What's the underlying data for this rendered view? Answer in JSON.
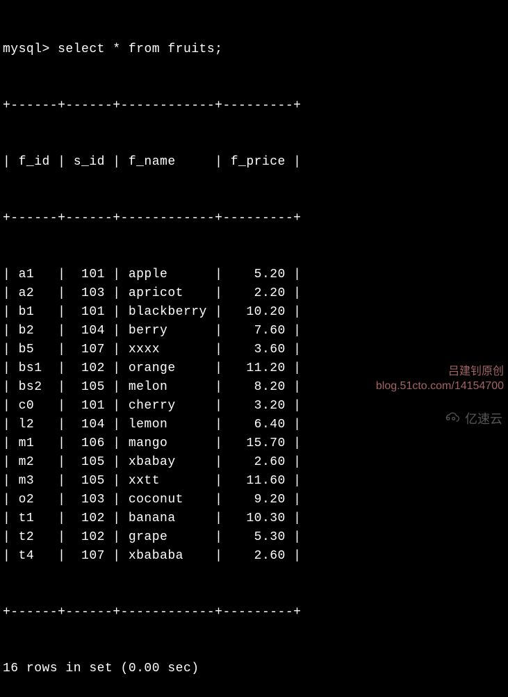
{
  "prompt": "mysql>",
  "query": "select * from fruits;",
  "headers": [
    "f_id",
    "s_id",
    "f_name",
    "f_price"
  ],
  "rows": [
    {
      "f_id": "a1",
      "s_id": "101",
      "f_name": "apple",
      "f_price": "5.20"
    },
    {
      "f_id": "a2",
      "s_id": "103",
      "f_name": "apricot",
      "f_price": "2.20"
    },
    {
      "f_id": "b1",
      "s_id": "101",
      "f_name": "blackberry",
      "f_price": "10.20"
    },
    {
      "f_id": "b2",
      "s_id": "104",
      "f_name": "berry",
      "f_price": "7.60"
    },
    {
      "f_id": "b5",
      "s_id": "107",
      "f_name": "xxxx",
      "f_price": "3.60"
    },
    {
      "f_id": "bs1",
      "s_id": "102",
      "f_name": "orange",
      "f_price": "11.20"
    },
    {
      "f_id": "bs2",
      "s_id": "105",
      "f_name": "melon",
      "f_price": "8.20"
    },
    {
      "f_id": "c0",
      "s_id": "101",
      "f_name": "cherry",
      "f_price": "3.20"
    },
    {
      "f_id": "l2",
      "s_id": "104",
      "f_name": "lemon",
      "f_price": "6.40"
    },
    {
      "f_id": "m1",
      "s_id": "106",
      "f_name": "mango",
      "f_price": "15.70"
    },
    {
      "f_id": "m2",
      "s_id": "105",
      "f_name": "xbabay",
      "f_price": "2.60"
    },
    {
      "f_id": "m3",
      "s_id": "105",
      "f_name": "xxtt",
      "f_price": "11.60"
    },
    {
      "f_id": "o2",
      "s_id": "103",
      "f_name": "coconut",
      "f_price": "9.20"
    },
    {
      "f_id": "t1",
      "s_id": "102",
      "f_name": "banana",
      "f_price": "10.30"
    },
    {
      "f_id": "t2",
      "s_id": "102",
      "f_name": "grape",
      "f_price": "5.30"
    },
    {
      "f_id": "t4",
      "s_id": "107",
      "f_name": "xbababa",
      "f_price": "2.60"
    }
  ],
  "border": "+------+------+------------+---------+",
  "footer": "16 rows in set (0.00 sec)",
  "watermark1_line1": "吕建钊原创",
  "watermark1_line2": "blog.51cto.com/14154700",
  "watermark2": "亿速云"
}
